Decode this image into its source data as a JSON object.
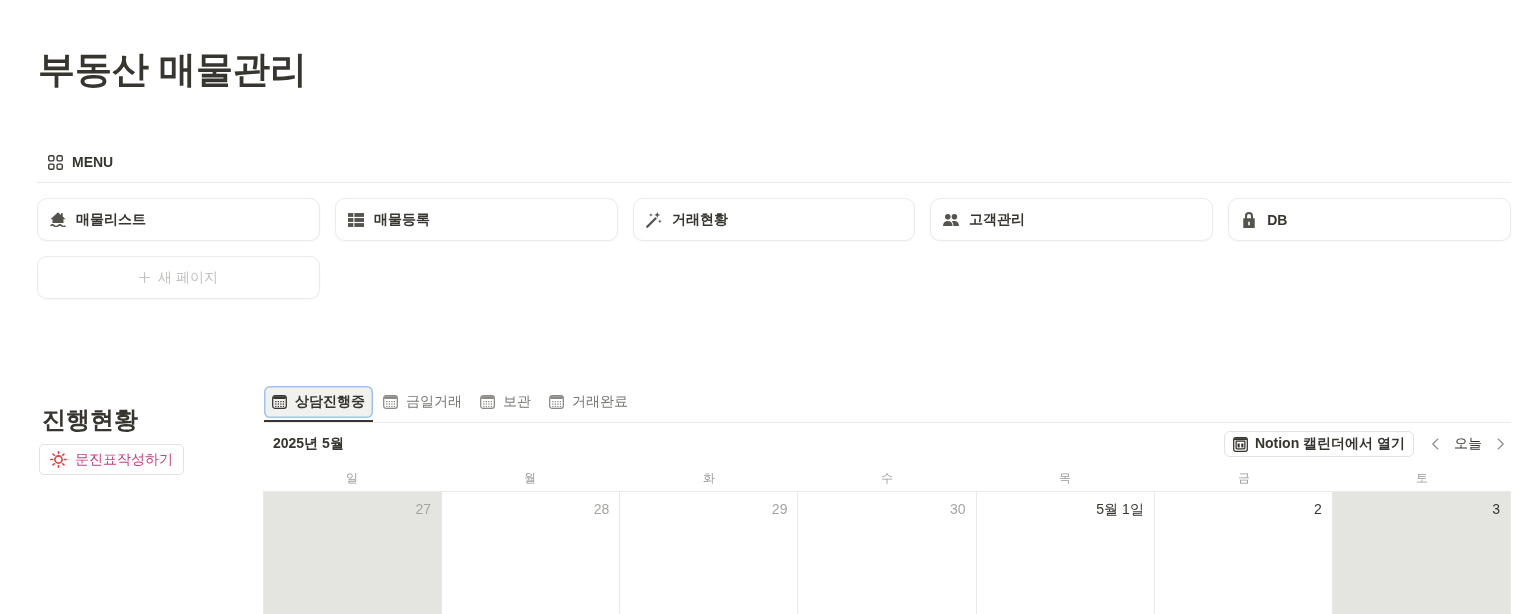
{
  "page": {
    "title": "부동산 매물관리"
  },
  "menu": {
    "label": "MENU",
    "links": [
      "매물리스트",
      "매물등록",
      "거래현황",
      "고객관리",
      "DB"
    ],
    "new_page": {
      "label": "새 페이지"
    }
  },
  "progress": {
    "heading": "진행현황",
    "button": {
      "label": "문진표작성하기"
    }
  },
  "calendar": {
    "tabs": [
      {
        "label": "상담진행중",
        "selected": true
      },
      {
        "label": "금일거래",
        "selected": false
      },
      {
        "label": "보관",
        "selected": false
      },
      {
        "label": "거래완료",
        "selected": false
      }
    ],
    "month": "2025년 5월",
    "open_button": "Notion 캘린더에서 열기",
    "today_button": "오늘",
    "weekdays": [
      "일",
      "월",
      "화",
      "수",
      "목",
      "금",
      "토"
    ],
    "days": [
      {
        "label": "27",
        "current_month": false,
        "weekend": true
      },
      {
        "label": "28",
        "current_month": false,
        "weekend": false
      },
      {
        "label": "29",
        "current_month": false,
        "weekend": false
      },
      {
        "label": "30",
        "current_month": false,
        "weekend": false
      },
      {
        "label": "5월 1일",
        "current_month": true,
        "weekend": false
      },
      {
        "label": "2",
        "current_month": true,
        "weekend": false
      },
      {
        "label": "3",
        "current_month": true,
        "weekend": true
      }
    ]
  }
}
